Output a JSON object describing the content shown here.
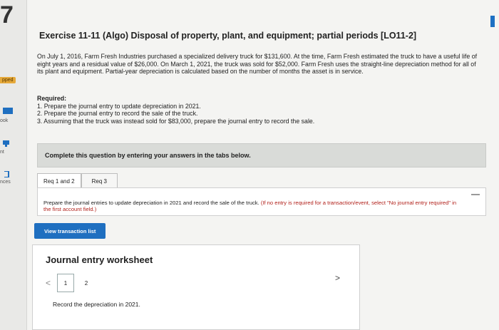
{
  "sidebar": {
    "question_number": "7",
    "badge": "pped",
    "items": [
      {
        "label": "ook",
        "icon": "book-icon"
      },
      {
        "label": "nt",
        "icon": "print-icon"
      },
      {
        "label": "nces",
        "icon": "references-icon"
      }
    ]
  },
  "exercise": {
    "title": "Exercise 11-11 (Algo) Disposal of property, plant, and equipment; partial periods [LO11-2]",
    "intro": "On July 1, 2016, Farm Fresh Industries purchased a specialized delivery truck for $131,600. At the time, Farm Fresh estimated the truck to have a useful life of eight years and a residual value of $26,000. On March 1, 2021, the truck was sold for $52,000. Farm Fresh uses the straight-line depreciation method for all of its plant and equipment. Partial-year depreciation is calculated based on the number of months the asset is in service.",
    "required_heading": "Required:",
    "required_items": [
      "1. Prepare the journal entry to update depreciation in 2021.",
      "2. Prepare the journal entry to record the sale of the truck.",
      "3. Assuming that the truck was instead sold for $83,000, prepare the journal entry to record the sale."
    ]
  },
  "banner": {
    "text": "Complete this question by entering your answers in the tabs below."
  },
  "tabs": [
    {
      "label": "Req 1 and 2",
      "active": true
    },
    {
      "label": "Req 3",
      "active": false
    }
  ],
  "tab_panel": {
    "instruction": "Prepare the journal entries to update depreciation in 2021 and record the sale of the truck.",
    "note": "(If no entry is required for a transaction/event, select \"No journal entry required\" in the first account field.)"
  },
  "view_button": {
    "label": "View transaction list"
  },
  "worksheet": {
    "title": "Journal entry worksheet",
    "pages": [
      "1",
      "2"
    ],
    "prev": "<",
    "next": ">",
    "text": "Record the depreciation in 2021."
  },
  "colors": {
    "accent": "#1f6fc0",
    "badge": "#e6a93a",
    "note": "#b2211b"
  }
}
